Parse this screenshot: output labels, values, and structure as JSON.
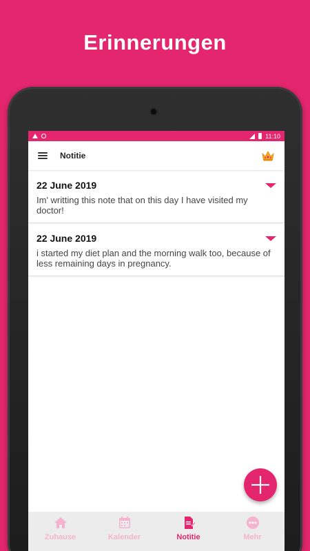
{
  "promo": {
    "title": "Erinnerungen"
  },
  "status": {
    "time": "11:10"
  },
  "appbar": {
    "title": "Notitie"
  },
  "notes": [
    {
      "date": "22 June 2019",
      "text": "Im' writting this note that on this day I have visited my doctor!"
    },
    {
      "date": "22 June 2019",
      "text": "i started my diet plan and  the morning walk too, because of less remaining days in pregnancy."
    }
  ],
  "nav": {
    "items": [
      {
        "label": "Zuhause",
        "icon": "home-icon"
      },
      {
        "label": "Kalender",
        "icon": "calendar-icon"
      },
      {
        "label": "Notitie",
        "icon": "note-edit-icon",
        "active": true
      },
      {
        "label": "Mehr",
        "icon": "more-icon"
      }
    ]
  },
  "colors": {
    "accent": "#E4266E",
    "nav_inactive": "#F5B4CD",
    "nav_bg": "#ECECEC"
  }
}
